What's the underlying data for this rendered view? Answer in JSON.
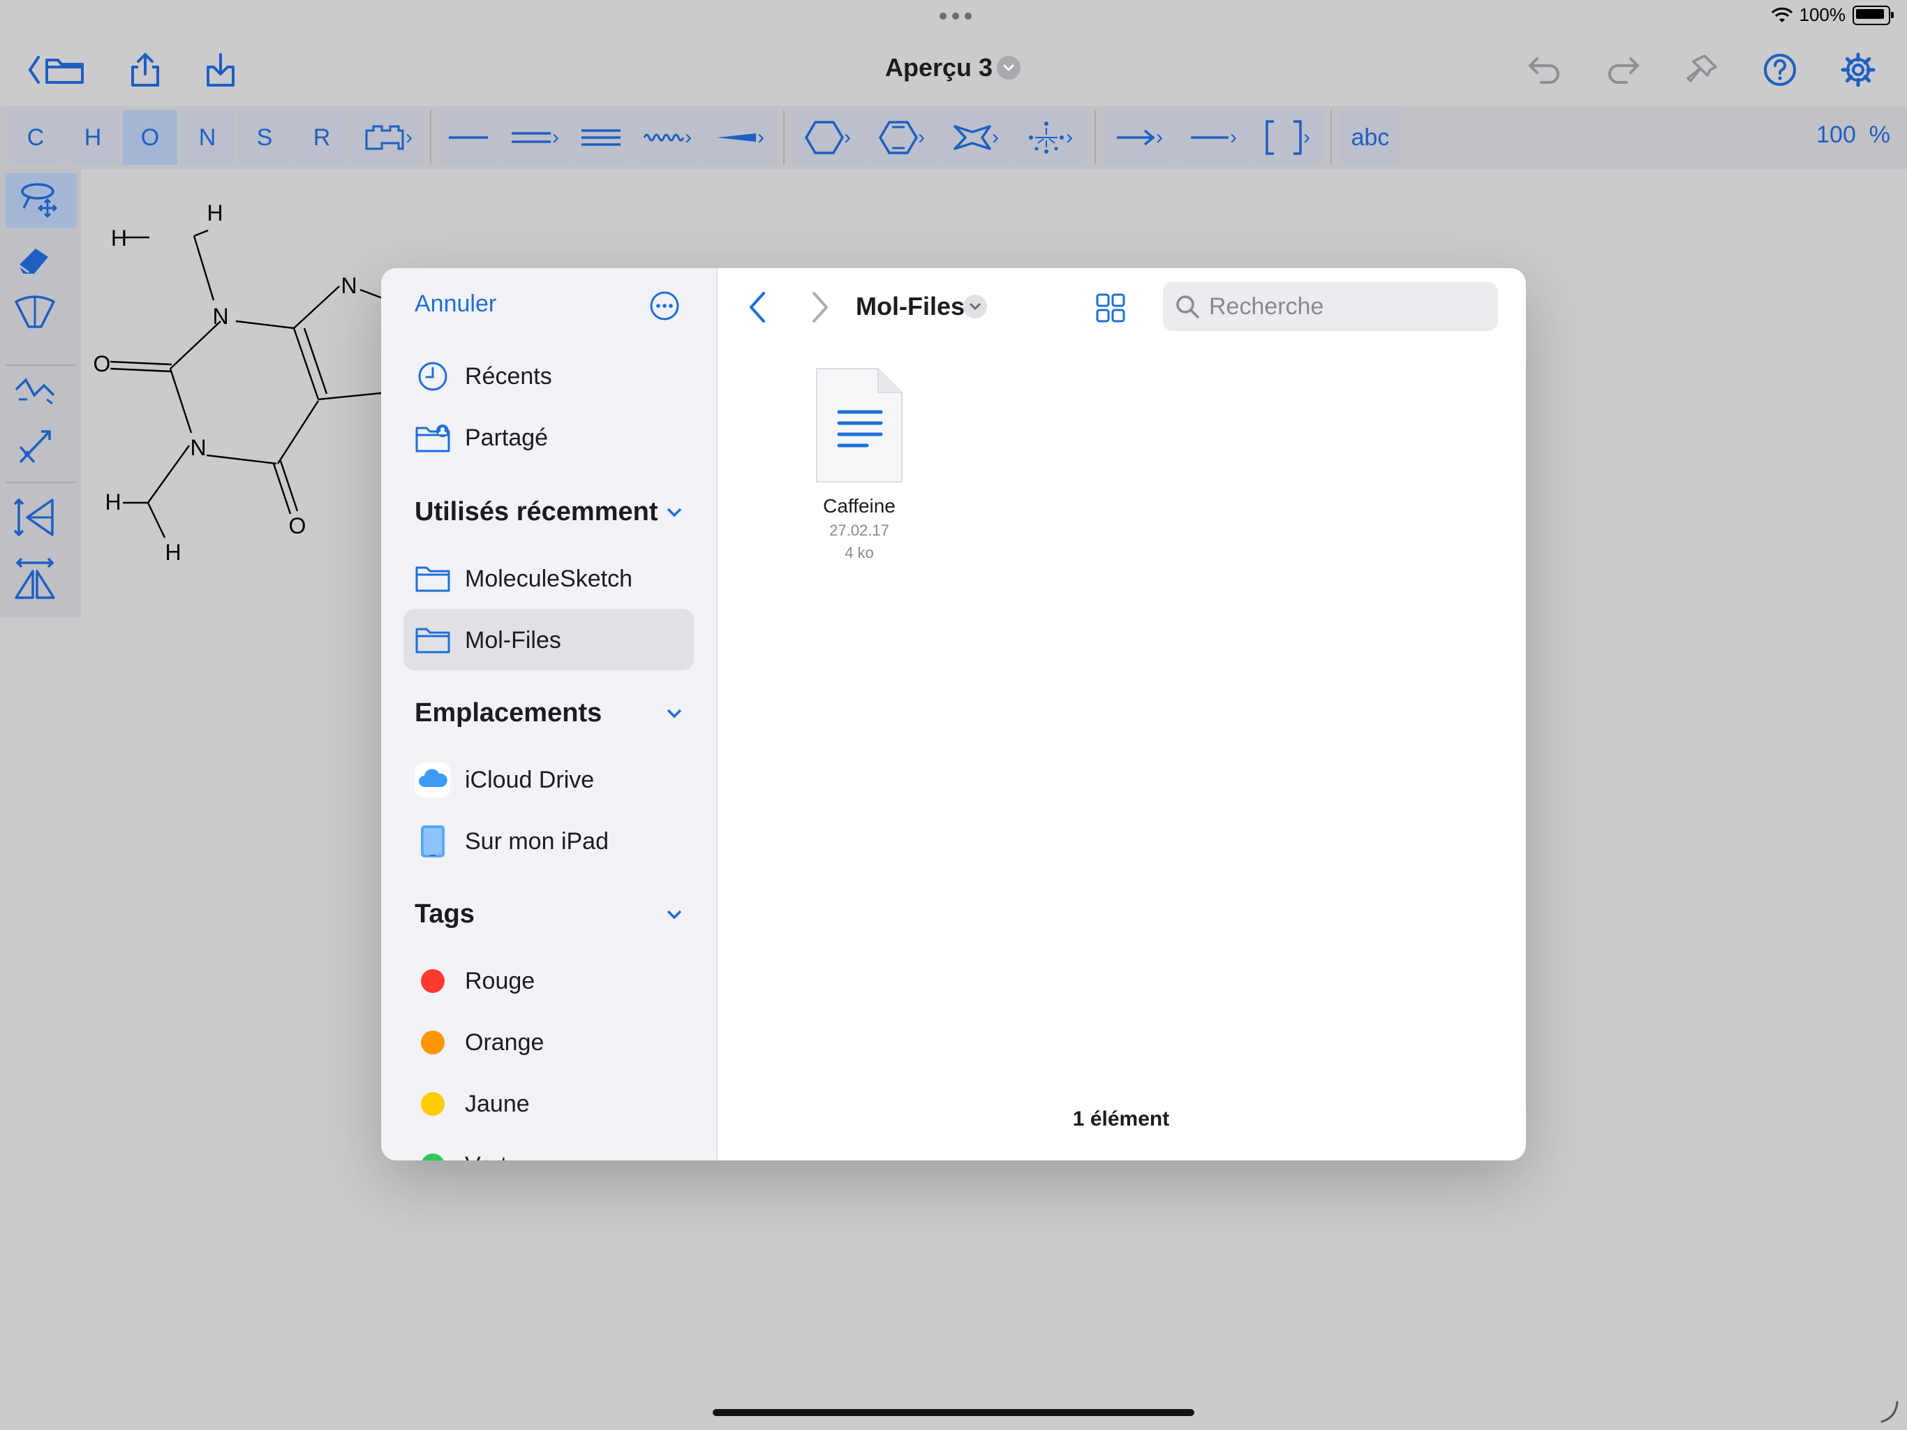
{
  "status": {
    "battery_percent": "100%"
  },
  "app": {
    "title": "Aperçu 3",
    "zoom": "100",
    "zoom_unit": "%"
  },
  "toolbar": {
    "elements": [
      "C",
      "H",
      "O",
      "N",
      "S",
      "R"
    ],
    "selected_element": "O",
    "text_tool": "abc"
  },
  "molecule": {
    "atoms": [
      "H",
      "H",
      "N",
      "O",
      "N",
      "N",
      "O",
      "H",
      "H"
    ]
  },
  "dialog": {
    "cancel": "Annuler",
    "sidebar": {
      "top_items": [
        "Récents",
        "Partagé"
      ],
      "recent_header": "Utilisés récemment",
      "recent_items": [
        "MoleculeSketch",
        "Mol-Files"
      ],
      "selected_folder": "Mol-Files",
      "locations_header": "Emplacements",
      "locations": [
        "iCloud Drive",
        "Sur mon iPad"
      ],
      "tags_header": "Tags",
      "tags": [
        {
          "label": "Rouge",
          "color": "#ff3b30"
        },
        {
          "label": "Orange",
          "color": "#ff9500"
        },
        {
          "label": "Jaune",
          "color": "#ffcc00"
        },
        {
          "label": "Vert",
          "color": "#34c759"
        }
      ]
    },
    "folder_title": "Mol-Files",
    "search_placeholder": "Recherche",
    "files": [
      {
        "name": "Caffeine",
        "date": "27.02.17",
        "size": "4 ko"
      }
    ],
    "item_count": "1 élément"
  },
  "colors": {
    "accent": "#1e6fd8",
    "tool_blue": "#1e5fc2",
    "selected_tool": "#a3b6d6"
  }
}
